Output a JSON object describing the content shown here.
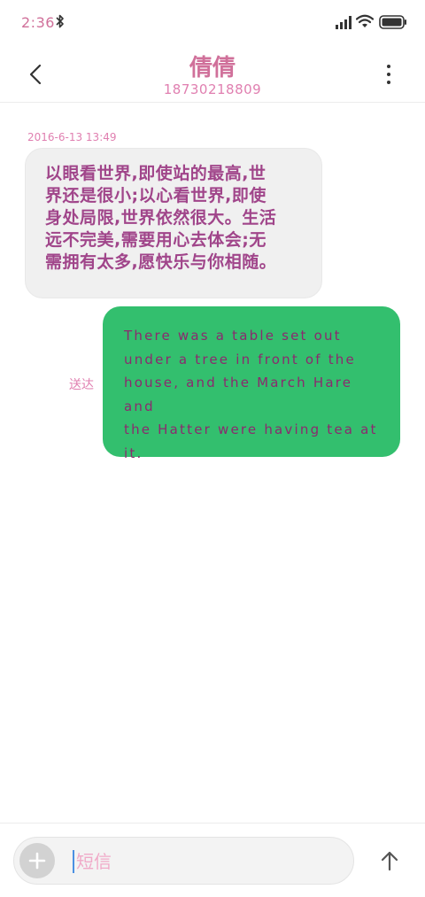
{
  "status_bar": {
    "time": "2:36",
    "icons": [
      "bluetooth-icon",
      "signal-icon",
      "wifi-icon",
      "battery-icon"
    ]
  },
  "header": {
    "contact_name": "倩倩",
    "phone_number": "18730218809",
    "icons": [
      "back-arrow-icon",
      "more-vert-icon"
    ]
  },
  "conversation": {
    "incoming": {
      "timestamp": "2016-6-13 13:49",
      "lines": [
        "以眼看世界,即使站的最高,世",
        "界还是很小;以心看世界,即使",
        "身处局限,世界依然很大。生活",
        "远不完美,需要用心去体会;无",
        "需拥有太多,愿快乐与你相随。"
      ]
    },
    "outgoing": {
      "status": "送达",
      "lines": [
        "There was a table set out",
        "under a tree in front of the",
        "house, and the March Hare and",
        "the Hatter were having tea at",
        "it."
      ]
    }
  },
  "composer": {
    "placeholder": "短信",
    "value": "",
    "icons": [
      "add-icon",
      "send-arrow-icon"
    ]
  },
  "colors": {
    "accent_pink": "#d0709a",
    "outgoing_bubble": "#33bf6e",
    "incoming_bubble": "#f0f0f0"
  }
}
